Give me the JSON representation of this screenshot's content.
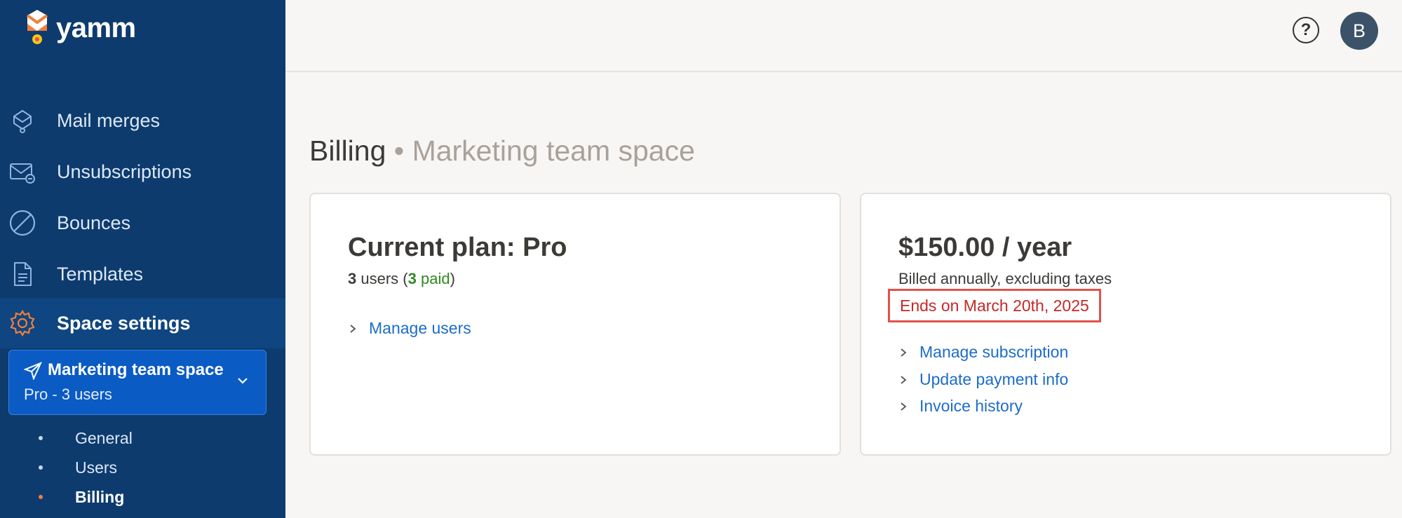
{
  "app": {
    "logo_text": "yamm"
  },
  "sidebar": {
    "items": [
      {
        "label": "Mail merges",
        "icon": "mail-merge-icon"
      },
      {
        "label": "Unsubscriptions",
        "icon": "unsubscribe-mail-icon"
      },
      {
        "label": "Bounces",
        "icon": "bounce-icon"
      },
      {
        "label": "Templates",
        "icon": "template-document-icon"
      },
      {
        "label": "Space settings",
        "icon": "gear-icon",
        "active": true
      }
    ],
    "space": {
      "name": "Marketing team space",
      "plan": "Pro - 3 users"
    },
    "sub_items": [
      {
        "label": "General"
      },
      {
        "label": "Users"
      },
      {
        "label": "Billing",
        "active": true
      }
    ]
  },
  "topbar": {
    "help_label": "?",
    "avatar_initial": "B"
  },
  "page": {
    "title": "Billing",
    "separator": "•",
    "space_name": "Marketing team space"
  },
  "plan_card": {
    "title": "Current plan: Pro",
    "users_count": "3",
    "users_word": "users (",
    "paid_count": "3",
    "paid_word": "paid",
    "close_paren": ")",
    "links": [
      "Manage users"
    ]
  },
  "price_card": {
    "price": "$150.00 / year",
    "billing_note": "Billed annually, excluding taxes",
    "end_date": "Ends on March 20th, 2025",
    "links": [
      "Manage subscription",
      "Update payment info",
      "Invoice history"
    ]
  },
  "colors": {
    "sidebar_bg": "#0d3b6e",
    "space_card_bg": "#0a5bc4",
    "link": "#1c6cc9",
    "accent_orange": "#f07f3c",
    "highlight_red": "#e0524b",
    "paid_green": "#2e8a22"
  }
}
